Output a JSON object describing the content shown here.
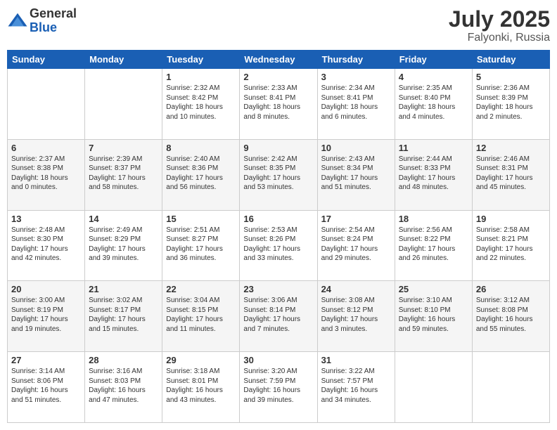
{
  "logo": {
    "general": "General",
    "blue": "Blue"
  },
  "title": {
    "month_year": "July 2025",
    "location": "Falyonki, Russia"
  },
  "weekdays": [
    "Sunday",
    "Monday",
    "Tuesday",
    "Wednesday",
    "Thursday",
    "Friday",
    "Saturday"
  ],
  "weeks": [
    [
      {
        "day": "",
        "content": ""
      },
      {
        "day": "",
        "content": ""
      },
      {
        "day": "1",
        "content": "Sunrise: 2:32 AM\nSunset: 8:42 PM\nDaylight: 18 hours and 10 minutes."
      },
      {
        "day": "2",
        "content": "Sunrise: 2:33 AM\nSunset: 8:41 PM\nDaylight: 18 hours and 8 minutes."
      },
      {
        "day": "3",
        "content": "Sunrise: 2:34 AM\nSunset: 8:41 PM\nDaylight: 18 hours and 6 minutes."
      },
      {
        "day": "4",
        "content": "Sunrise: 2:35 AM\nSunset: 8:40 PM\nDaylight: 18 hours and 4 minutes."
      },
      {
        "day": "5",
        "content": "Sunrise: 2:36 AM\nSunset: 8:39 PM\nDaylight: 18 hours and 2 minutes."
      }
    ],
    [
      {
        "day": "6",
        "content": "Sunrise: 2:37 AM\nSunset: 8:38 PM\nDaylight: 18 hours and 0 minutes."
      },
      {
        "day": "7",
        "content": "Sunrise: 2:39 AM\nSunset: 8:37 PM\nDaylight: 17 hours and 58 minutes."
      },
      {
        "day": "8",
        "content": "Sunrise: 2:40 AM\nSunset: 8:36 PM\nDaylight: 17 hours and 56 minutes."
      },
      {
        "day": "9",
        "content": "Sunrise: 2:42 AM\nSunset: 8:35 PM\nDaylight: 17 hours and 53 minutes."
      },
      {
        "day": "10",
        "content": "Sunrise: 2:43 AM\nSunset: 8:34 PM\nDaylight: 17 hours and 51 minutes."
      },
      {
        "day": "11",
        "content": "Sunrise: 2:44 AM\nSunset: 8:33 PM\nDaylight: 17 hours and 48 minutes."
      },
      {
        "day": "12",
        "content": "Sunrise: 2:46 AM\nSunset: 8:31 PM\nDaylight: 17 hours and 45 minutes."
      }
    ],
    [
      {
        "day": "13",
        "content": "Sunrise: 2:48 AM\nSunset: 8:30 PM\nDaylight: 17 hours and 42 minutes."
      },
      {
        "day": "14",
        "content": "Sunrise: 2:49 AM\nSunset: 8:29 PM\nDaylight: 17 hours and 39 minutes."
      },
      {
        "day": "15",
        "content": "Sunrise: 2:51 AM\nSunset: 8:27 PM\nDaylight: 17 hours and 36 minutes."
      },
      {
        "day": "16",
        "content": "Sunrise: 2:53 AM\nSunset: 8:26 PM\nDaylight: 17 hours and 33 minutes."
      },
      {
        "day": "17",
        "content": "Sunrise: 2:54 AM\nSunset: 8:24 PM\nDaylight: 17 hours and 29 minutes."
      },
      {
        "day": "18",
        "content": "Sunrise: 2:56 AM\nSunset: 8:22 PM\nDaylight: 17 hours and 26 minutes."
      },
      {
        "day": "19",
        "content": "Sunrise: 2:58 AM\nSunset: 8:21 PM\nDaylight: 17 hours and 22 minutes."
      }
    ],
    [
      {
        "day": "20",
        "content": "Sunrise: 3:00 AM\nSunset: 8:19 PM\nDaylight: 17 hours and 19 minutes."
      },
      {
        "day": "21",
        "content": "Sunrise: 3:02 AM\nSunset: 8:17 PM\nDaylight: 17 hours and 15 minutes."
      },
      {
        "day": "22",
        "content": "Sunrise: 3:04 AM\nSunset: 8:15 PM\nDaylight: 17 hours and 11 minutes."
      },
      {
        "day": "23",
        "content": "Sunrise: 3:06 AM\nSunset: 8:14 PM\nDaylight: 17 hours and 7 minutes."
      },
      {
        "day": "24",
        "content": "Sunrise: 3:08 AM\nSunset: 8:12 PM\nDaylight: 17 hours and 3 minutes."
      },
      {
        "day": "25",
        "content": "Sunrise: 3:10 AM\nSunset: 8:10 PM\nDaylight: 16 hours and 59 minutes."
      },
      {
        "day": "26",
        "content": "Sunrise: 3:12 AM\nSunset: 8:08 PM\nDaylight: 16 hours and 55 minutes."
      }
    ],
    [
      {
        "day": "27",
        "content": "Sunrise: 3:14 AM\nSunset: 8:06 PM\nDaylight: 16 hours and 51 minutes."
      },
      {
        "day": "28",
        "content": "Sunrise: 3:16 AM\nSunset: 8:03 PM\nDaylight: 16 hours and 47 minutes."
      },
      {
        "day": "29",
        "content": "Sunrise: 3:18 AM\nSunset: 8:01 PM\nDaylight: 16 hours and 43 minutes."
      },
      {
        "day": "30",
        "content": "Sunrise: 3:20 AM\nSunset: 7:59 PM\nDaylight: 16 hours and 39 minutes."
      },
      {
        "day": "31",
        "content": "Sunrise: 3:22 AM\nSunset: 7:57 PM\nDaylight: 16 hours and 34 minutes."
      },
      {
        "day": "",
        "content": ""
      },
      {
        "day": "",
        "content": ""
      }
    ]
  ]
}
